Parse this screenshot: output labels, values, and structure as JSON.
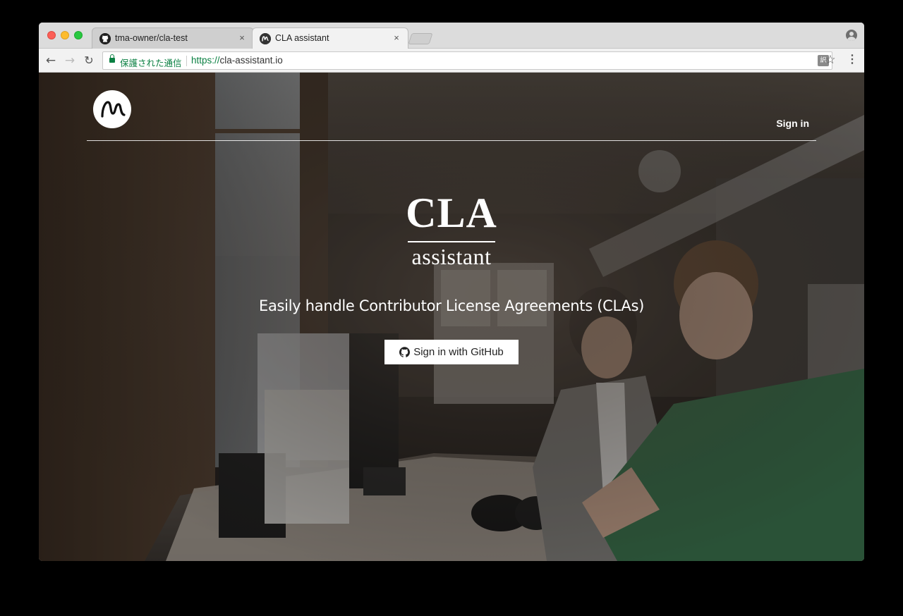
{
  "browser": {
    "tabs": [
      {
        "title": "tma-owner/cla-test",
        "icon": "github-icon",
        "active": false
      },
      {
        "title": "CLA assistant",
        "icon": "cla-assistant-icon",
        "active": true
      }
    ],
    "close_glyph": "×",
    "nav": {
      "back": "←",
      "forward": "→",
      "reload": "↻"
    },
    "security_label": "保護された通信",
    "url": {
      "scheme": "https://",
      "host": "cla-assistant.io"
    },
    "translate_glyph": "訳",
    "bookmark_glyph": "☆",
    "menu_glyph": "⋮"
  },
  "page": {
    "header": {
      "logo_icon": "cla-assistant-logo",
      "signin_label": "Sign in"
    },
    "hero": {
      "title_top": "CLA",
      "title_bottom": "assistant",
      "tagline": "Easily handle Contributor License Agreements (CLAs)",
      "button_label": "Sign in with GitHub",
      "button_icon": "github-icon"
    }
  },
  "colors": {
    "secure_green": "#0b8043",
    "overlay": "rgba(0,0,0,0.32)",
    "button_bg": "#ffffff",
    "hero_text": "#ffffff"
  }
}
